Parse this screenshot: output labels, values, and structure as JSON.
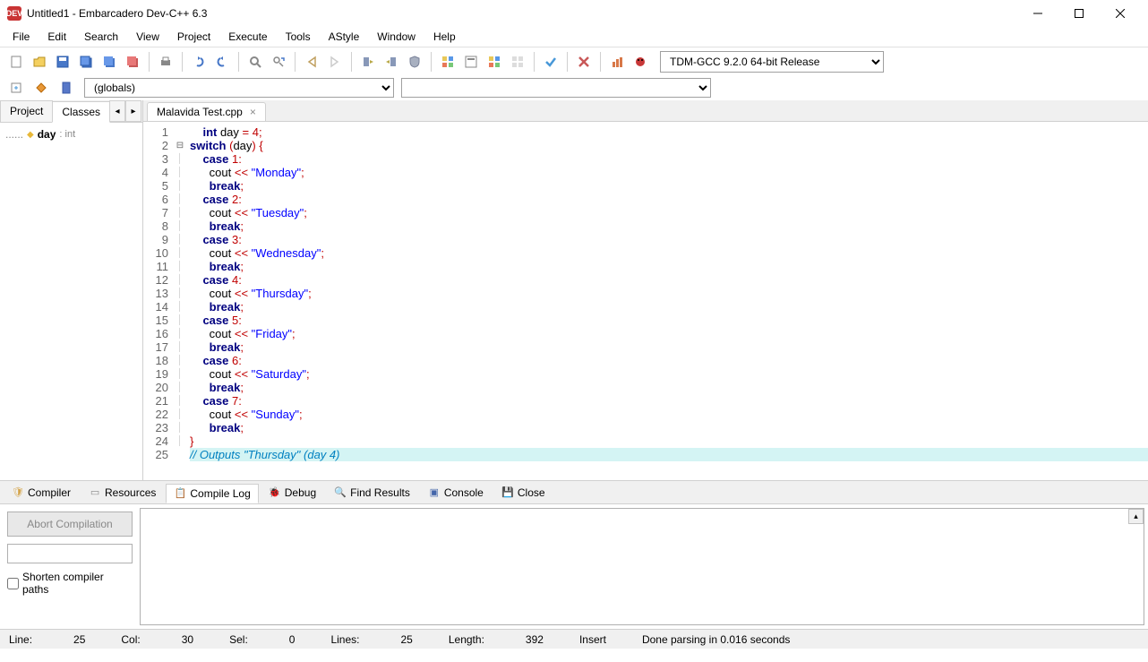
{
  "titlebar": {
    "title": "Untitled1 - Embarcadero Dev-C++ 6.3",
    "app_icon": "DEV"
  },
  "menubar": [
    "File",
    "Edit",
    "Search",
    "View",
    "Project",
    "Execute",
    "Tools",
    "AStyle",
    "Window",
    "Help"
  ],
  "toolbar": {
    "compiler_select": "TDM-GCC 9.2.0 64-bit Release"
  },
  "secondbar": {
    "globals": "(globals)"
  },
  "left_panel": {
    "tabs": [
      "Project",
      "Classes"
    ],
    "active_tab": 1,
    "tree": {
      "var_name": "day",
      "var_type": ": int",
      "dots": "......"
    }
  },
  "file_tab": {
    "name": "Malavida Test.cpp"
  },
  "code": {
    "lines": [
      {
        "n": 1,
        "html": "    <span class='kw-bold'>int</span> day <span class='op'>=</span> <span class='num'>4</span><span class='op'>;</span>"
      },
      {
        "n": 2,
        "html": "<span class='kw-bold'>switch</span> <span class='op'>(</span>day<span class='op'>)</span> <span class='op'>{</span>",
        "fold": "⊟"
      },
      {
        "n": 3,
        "html": "    <span class='kw-bold'>case</span> <span class='num'>1</span><span class='op'>:</span>"
      },
      {
        "n": 4,
        "html": "      cout <span class='op'>&lt;&lt;</span> <span class='str'>\"Monday\"</span><span class='op'>;</span>"
      },
      {
        "n": 5,
        "html": "      <span class='kw-bold'>break</span><span class='op'>;</span>"
      },
      {
        "n": 6,
        "html": "    <span class='kw-bold'>case</span> <span class='num'>2</span><span class='op'>:</span>"
      },
      {
        "n": 7,
        "html": "      cout <span class='op'>&lt;&lt;</span> <span class='str'>\"Tuesday\"</span><span class='op'>;</span>"
      },
      {
        "n": 8,
        "html": "      <span class='kw-bold'>break</span><span class='op'>;</span>"
      },
      {
        "n": 9,
        "html": "    <span class='kw-bold'>case</span> <span class='num'>3</span><span class='op'>:</span>"
      },
      {
        "n": 10,
        "html": "      cout <span class='op'>&lt;&lt;</span> <span class='str'>\"Wednesday\"</span><span class='op'>;</span>"
      },
      {
        "n": 11,
        "html": "      <span class='kw-bold'>break</span><span class='op'>;</span>"
      },
      {
        "n": 12,
        "html": "    <span class='kw-bold'>case</span> <span class='num'>4</span><span class='op'>:</span>"
      },
      {
        "n": 13,
        "html": "      cout <span class='op'>&lt;&lt;</span> <span class='str'>\"Thursday\"</span><span class='op'>;</span>"
      },
      {
        "n": 14,
        "html": "      <span class='kw-bold'>break</span><span class='op'>;</span>"
      },
      {
        "n": 15,
        "html": "    <span class='kw-bold'>case</span> <span class='num'>5</span><span class='op'>:</span>"
      },
      {
        "n": 16,
        "html": "      cout <span class='op'>&lt;&lt;</span> <span class='str'>\"Friday\"</span><span class='op'>;</span>"
      },
      {
        "n": 17,
        "html": "      <span class='kw-bold'>break</span><span class='op'>;</span>"
      },
      {
        "n": 18,
        "html": "    <span class='kw-bold'>case</span> <span class='num'>6</span><span class='op'>:</span>"
      },
      {
        "n": 19,
        "html": "      cout <span class='op'>&lt;&lt;</span> <span class='str'>\"Saturday\"</span><span class='op'>;</span>"
      },
      {
        "n": 20,
        "html": "      <span class='kw-bold'>break</span><span class='op'>;</span>"
      },
      {
        "n": 21,
        "html": "    <span class='kw-bold'>case</span> <span class='num'>7</span><span class='op'>:</span>"
      },
      {
        "n": 22,
        "html": "      cout <span class='op'>&lt;&lt;</span> <span class='str'>\"Sunday\"</span><span class='op'>;</span>"
      },
      {
        "n": 23,
        "html": "      <span class='kw-bold'>break</span><span class='op'>;</span>"
      },
      {
        "n": 24,
        "html": "<span class='op'>}</span>"
      },
      {
        "n": 25,
        "html": "<span class='cmt'>// Outputs \"Thursday\" (day 4)</span>",
        "hl": true
      }
    ]
  },
  "bottom_tabs": [
    {
      "icon": "🛡",
      "label": "Compiler",
      "color": "#d4a44a"
    },
    {
      "icon": "▭",
      "label": "Resources",
      "color": "#888"
    },
    {
      "icon": "📋",
      "label": "Compile Log",
      "active": true,
      "color": "#5a8"
    },
    {
      "icon": "🐞",
      "label": "Debug",
      "color": "#c44"
    },
    {
      "icon": "🔍",
      "label": "Find Results",
      "color": "#48a"
    },
    {
      "icon": "▣",
      "label": "Console",
      "color": "#46a"
    },
    {
      "icon": "💾",
      "label": "Close",
      "color": "#c9a22b"
    }
  ],
  "bottom_left": {
    "abort": "Abort Compilation",
    "shorten": "Shorten compiler paths"
  },
  "statusbar": {
    "line_label": "Line:",
    "line_val": "25",
    "col_label": "Col:",
    "col_val": "30",
    "sel_label": "Sel:",
    "sel_val": "0",
    "lines_label": "Lines:",
    "lines_val": "25",
    "length_label": "Length:",
    "length_val": "392",
    "insert": "Insert",
    "message": "Done parsing in 0.016 seconds"
  }
}
